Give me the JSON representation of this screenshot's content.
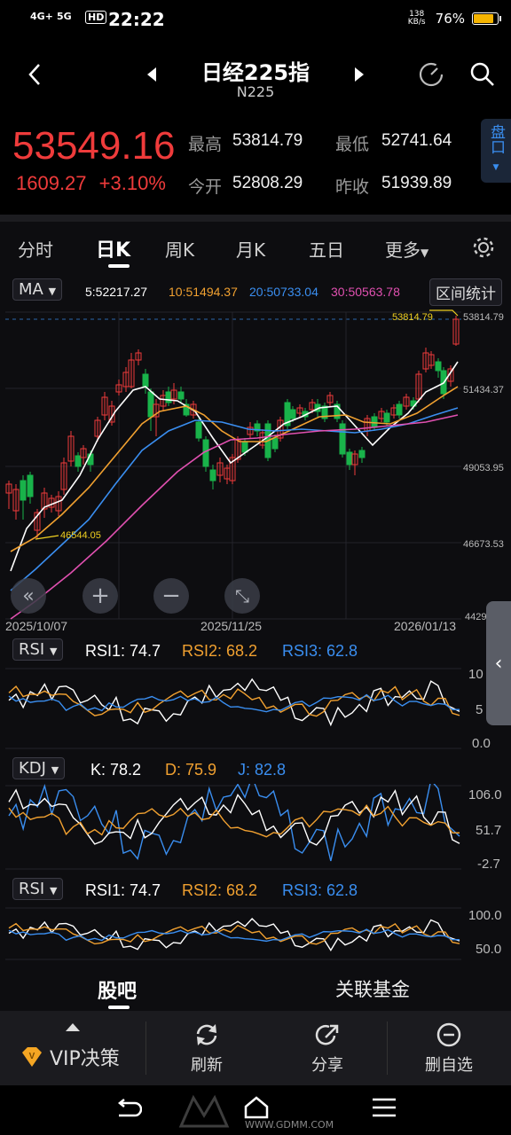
{
  "status_bar": {
    "signal1": "4G+",
    "signal2": "5G",
    "hd": "HD",
    "time": "22:22",
    "net_speed": "138 KB/s",
    "battery": "76%"
  },
  "header": {
    "title": "日经225指",
    "subtitle": "N225"
  },
  "quote": {
    "price": "53549.16",
    "change": "1609.27",
    "change_pct": "+3.10%",
    "high_label": "最高",
    "high": "53814.79",
    "low_label": "最低",
    "low": "52741.64",
    "open_label": "今开",
    "open": "52808.29",
    "prev_label": "昨收",
    "prev_close": "51939.89",
    "pankou": "盘口"
  },
  "tabs": [
    "分时",
    "日K",
    "周K",
    "月K",
    "五日",
    "更多"
  ],
  "ma_bar": {
    "selector": "MA",
    "ma5": "5:52217.27",
    "ma10": "10:51494.37",
    "ma20": "20:50733.04",
    "ma30": "30:50563.78",
    "range_stats": "区间统计"
  },
  "price_chart": {
    "axis_labels": [
      "53814.79",
      "51434.37",
      "49053.95",
      "46673.53",
      "4429"
    ],
    "high_marker": "53814.79",
    "low_marker": "46544.05",
    "dates": [
      "2025/10/07",
      "2025/11/25",
      "2026/01/13"
    ]
  },
  "rsi1": {
    "selector": "RSI",
    "r1": "RSI1: 74.7",
    "r2": "RSI2: 68.2",
    "r3": "RSI3: 62.8",
    "axis": [
      "10",
      "5",
      "0.0"
    ]
  },
  "kdj": {
    "selector": "KDJ",
    "k": "K: 78.2",
    "d": "D: 75.9",
    "j": "J: 82.8",
    "axis": [
      "106.0",
      "51.7",
      "-2.7"
    ]
  },
  "rsi2": {
    "selector": "RSI",
    "r1": "RSI1: 74.7",
    "r2": "RSI2: 68.2",
    "r3": "RSI3: 62.8",
    "axis": [
      "100.0",
      "50.0"
    ]
  },
  "bottom_tabs": [
    "股吧",
    "关联基金"
  ],
  "toolbar": {
    "vip": "VIP决策",
    "refresh": "刷新",
    "share": "分享",
    "remove": "删自选"
  },
  "watermark": "WWW.GDMM.COM",
  "colors": {
    "up": "#ef3b3b",
    "down": "#19b34a",
    "ma5": "#ffffff",
    "ma10": "#f0a030",
    "ma20": "#3a8ef0",
    "ma30": "#e050b0"
  }
}
